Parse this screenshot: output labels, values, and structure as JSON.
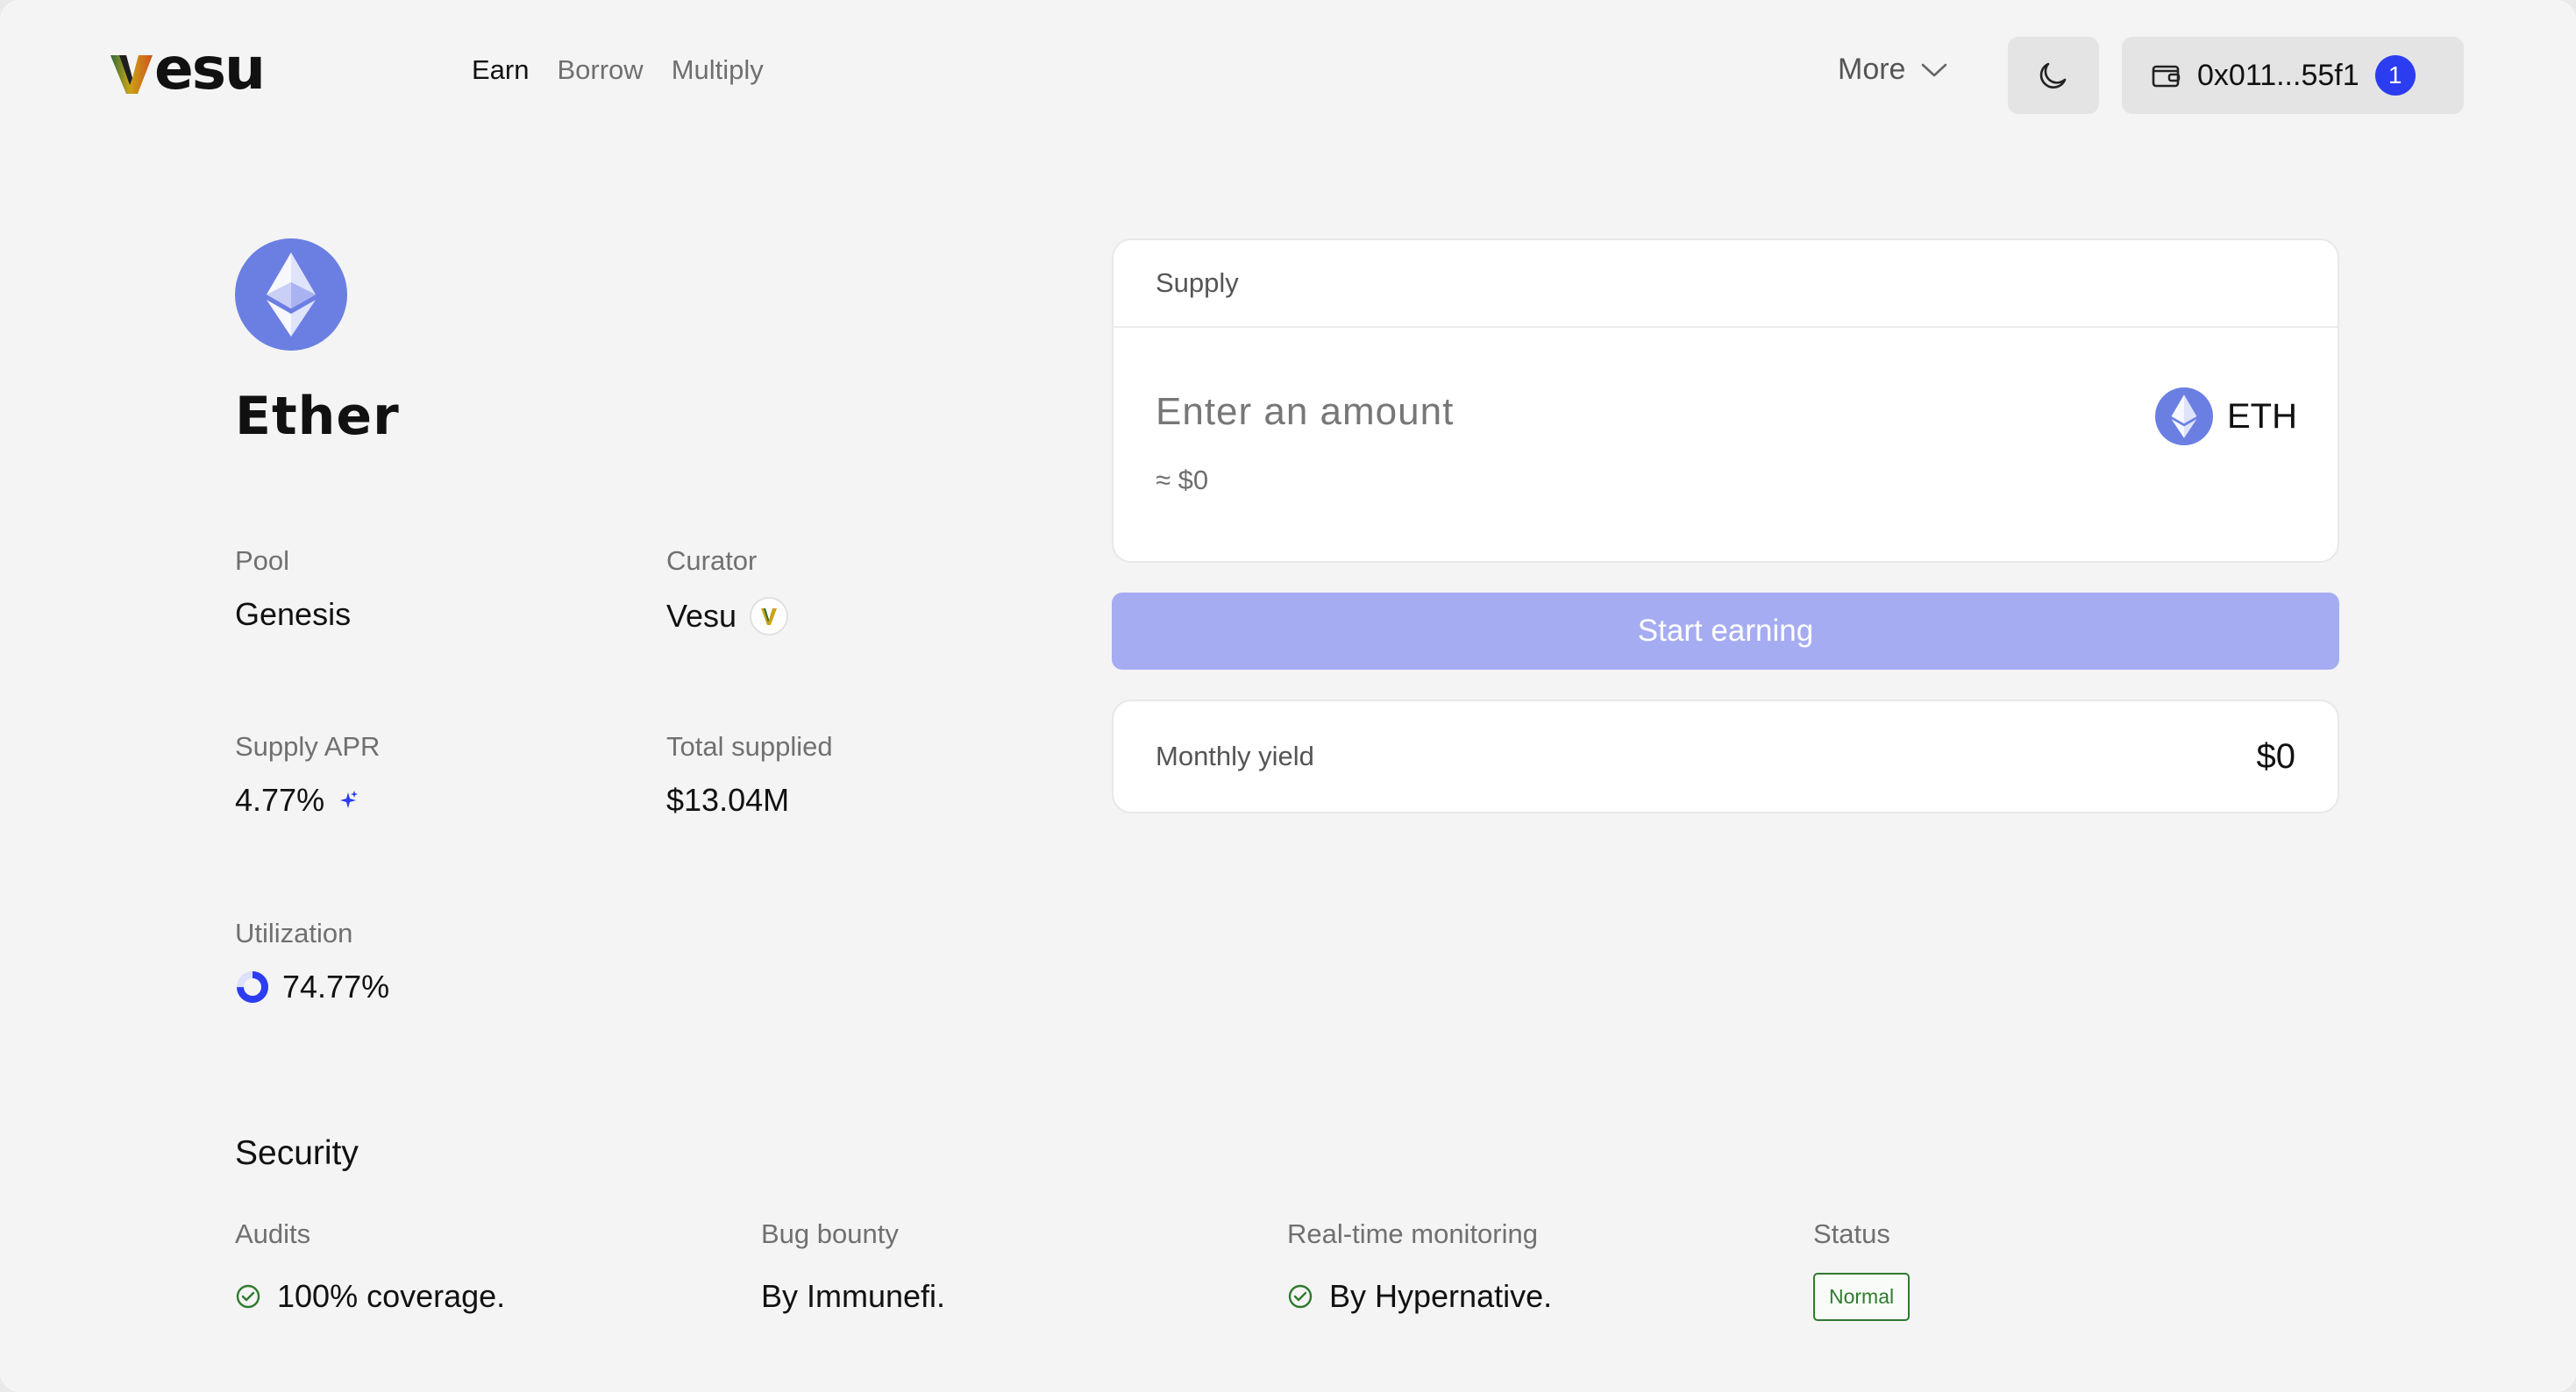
{
  "header": {
    "logo_text": "esu",
    "nav": [
      {
        "label": "Earn",
        "active": true
      },
      {
        "label": "Borrow",
        "active": false
      },
      {
        "label": "Multiply",
        "active": false
      }
    ],
    "more_label": "More",
    "wallet_address": "0x011...55f1",
    "wallet_badge": "1"
  },
  "asset": {
    "name": "Ether",
    "icon": "ethereum-icon"
  },
  "stats": {
    "pool": {
      "label": "Pool",
      "value": "Genesis"
    },
    "curator": {
      "label": "Curator",
      "value": "Vesu"
    },
    "supply_apr": {
      "label": "Supply APR",
      "value": "4.77%"
    },
    "total_supplied": {
      "label": "Total supplied",
      "value": "$13.04M"
    },
    "utilization": {
      "label": "Utilization",
      "value": "74.77%",
      "fraction": 0.7477
    }
  },
  "supply": {
    "title": "Supply",
    "placeholder": "Enter an amount",
    "usd_estimate": "≈ $0",
    "token": "ETH",
    "button_label": "Start earning"
  },
  "yield": {
    "label": "Monthly yield",
    "value": "$0"
  },
  "security": {
    "title": "Security",
    "audits": {
      "label": "Audits",
      "value": "100% coverage."
    },
    "bug_bounty": {
      "label": "Bug bounty",
      "value": "By Immunefi."
    },
    "monitoring": {
      "label": "Real-time monitoring",
      "value": "By Hypernative."
    },
    "status": {
      "label": "Status",
      "value": "Normal"
    }
  },
  "colors": {
    "accent": "#2c3cf0",
    "button_disabled": "#a6acf2",
    "eth_icon": "#6b7fe3",
    "status_green": "#2f7a2f"
  }
}
